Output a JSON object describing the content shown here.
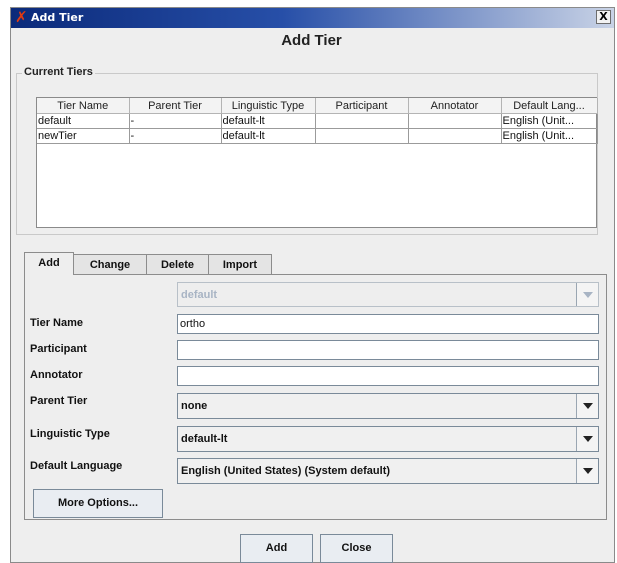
{
  "window": {
    "title": "Add Tier",
    "close_label": "X"
  },
  "heading": "Add Tier",
  "current_tiers": {
    "label": "Current Tiers",
    "columns": [
      "Tier Name",
      "Parent Tier",
      "Linguistic Type",
      "Participant",
      "Annotator",
      "Default Lang..."
    ],
    "rows": [
      [
        "default",
        "-",
        "default-lt",
        "",
        "",
        "English (Unit..."
      ],
      [
        "newTier",
        "-",
        "default-lt",
        "",
        "",
        "English (Unit..."
      ]
    ]
  },
  "tabs": [
    "Add",
    "Change",
    "Delete",
    "Import"
  ],
  "form": {
    "tier_select_value": "default",
    "tier_name_label": "Tier Name",
    "tier_name_value": "ortho",
    "participant_label": "Participant",
    "participant_value": "",
    "annotator_label": "Annotator",
    "annotator_value": "",
    "parent_tier_label": "Parent Tier",
    "parent_tier_value": "none",
    "linguistic_type_label": "Linguistic Type",
    "linguistic_type_value": "default-lt",
    "default_language_label": "Default Language",
    "default_language_value": "English (United States) (System default)",
    "more_options_label": "More Options..."
  },
  "buttons": {
    "add": "Add",
    "close": "Close"
  }
}
